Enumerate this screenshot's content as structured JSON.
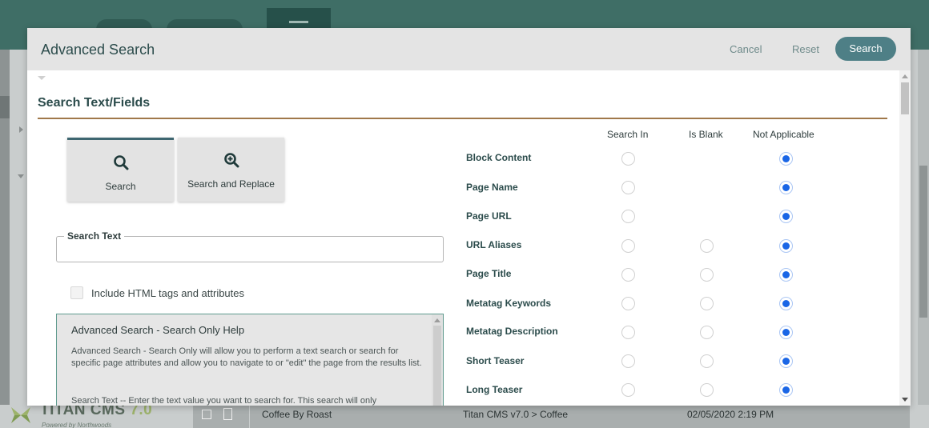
{
  "modal": {
    "title": "Advanced Search",
    "cancel_label": "Cancel",
    "reset_label": "Reset",
    "search_label": "Search"
  },
  "section": {
    "title": "Search Text/Fields"
  },
  "modes": [
    {
      "label": "Search",
      "icon": "search-icon",
      "active": true
    },
    {
      "label": "Search and Replace",
      "icon": "zoom-in-icon",
      "active": false
    }
  ],
  "search_text": {
    "legend": "Search Text",
    "value": ""
  },
  "include_html": {
    "label": "Include HTML tags and attributes",
    "checked": false
  },
  "help": {
    "title": "Advanced Search - Search Only Help",
    "p1": "Advanced Search - Search Only will allow you to perform a text search or search for specific page attributes and allow you to navigate to or \"edit\" the page from the results list.",
    "p2": "Search Text -- Enter the text value you want to search for. This search will only"
  },
  "columns": [
    "Search In",
    "Is Blank",
    "Not Applicable"
  ],
  "fields": [
    {
      "label": "Block Content",
      "has_blank": false,
      "selected": "Not Applicable"
    },
    {
      "label": "Page Name",
      "has_blank": false,
      "selected": "Not Applicable"
    },
    {
      "label": "Page URL",
      "has_blank": false,
      "selected": "Not Applicable"
    },
    {
      "label": "URL Aliases",
      "has_blank": true,
      "selected": "Not Applicable"
    },
    {
      "label": "Page Title",
      "has_blank": true,
      "selected": "Not Applicable"
    },
    {
      "label": "Metatag Keywords",
      "has_blank": true,
      "selected": "Not Applicable"
    },
    {
      "label": "Metatag Description",
      "has_blank": true,
      "selected": "Not Applicable"
    },
    {
      "label": "Short Teaser",
      "has_blank": true,
      "selected": "Not Applicable"
    },
    {
      "label": "Long Teaser",
      "has_blank": true,
      "selected": "Not Applicable"
    }
  ],
  "background": {
    "logo_text": "TITAN CMS",
    "logo_version": "7.0",
    "logo_tagline": "Powered by Northwoods",
    "row": {
      "name": "Coffee By Roast",
      "path_root": "Titan CMS v7.0",
      "path_sep": " > ",
      "path_leaf": "Coffee",
      "date": "02/05/2020 2:19 PM"
    }
  },
  "colors": {
    "accent": "#4e7f86",
    "header_bg": "#e4e4e4",
    "section_rule": "#a0784a",
    "radio_selected": "#1a66e6",
    "topbar": "#3f6e66"
  }
}
